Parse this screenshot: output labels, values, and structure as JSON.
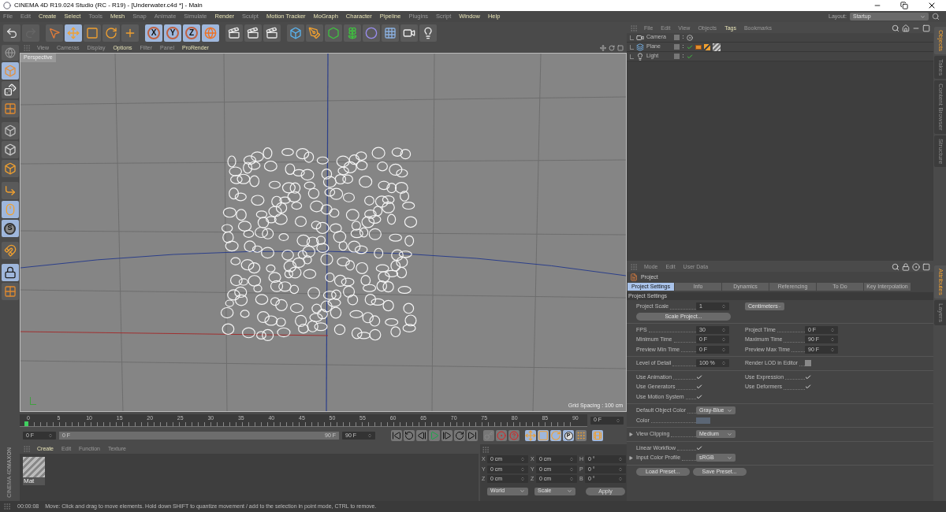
{
  "window": {
    "title": "CINEMA 4D R19.024 Studio (RC - R19) - [Underwater.c4d *] - Main"
  },
  "menubar": [
    {
      "label": "File",
      "highlighted": false
    },
    {
      "label": "Edit",
      "highlighted": false
    },
    {
      "label": "Create",
      "highlighted": true
    },
    {
      "label": "Select",
      "highlighted": true
    },
    {
      "label": "Tools",
      "highlighted": false
    },
    {
      "label": "Mesh",
      "highlighted": true
    },
    {
      "label": "Snap",
      "highlighted": false
    },
    {
      "label": "Animate",
      "highlighted": false
    },
    {
      "label": "Simulate",
      "highlighted": false
    },
    {
      "label": "Render",
      "highlighted": true
    },
    {
      "label": "Sculpt",
      "highlighted": false
    },
    {
      "label": "Motion Tracker",
      "highlighted": true
    },
    {
      "label": "MoGraph",
      "highlighted": true
    },
    {
      "label": "Character",
      "highlighted": true
    },
    {
      "label": "Pipeline",
      "highlighted": true
    },
    {
      "label": "Plugins",
      "highlighted": false
    },
    {
      "label": "Script",
      "highlighted": false
    },
    {
      "label": "Window",
      "highlighted": true
    },
    {
      "label": "Help",
      "highlighted": true
    }
  ],
  "layout": {
    "label": "Layout:",
    "value": "Startup"
  },
  "toolbar": [
    {
      "kind": "undo",
      "selected": false
    },
    {
      "kind": "redo",
      "selected": false
    },
    {
      "kind": "select",
      "selected": false
    },
    {
      "kind": "move",
      "selected": true
    },
    {
      "kind": "scale",
      "selected": false
    },
    {
      "kind": "rotate",
      "selected": false
    },
    {
      "kind": "add",
      "selected": false
    },
    {
      "kind": "axis",
      "label": "X",
      "selected": true
    },
    {
      "kind": "axis",
      "label": "Y",
      "selected": true
    },
    {
      "kind": "axis",
      "label": "Z",
      "selected": true
    },
    {
      "kind": "world",
      "selected": true
    },
    {
      "kind": "render",
      "selected": false
    },
    {
      "kind": "render",
      "selected": false
    },
    {
      "kind": "render",
      "selected": false
    },
    {
      "kind": "cube",
      "selected": false
    },
    {
      "kind": "pen",
      "selected": false
    },
    {
      "kind": "subdivision",
      "selected": false
    },
    {
      "kind": "cloner",
      "selected": false
    },
    {
      "kind": "deformer",
      "selected": false
    },
    {
      "kind": "floor",
      "selected": false
    },
    {
      "kind": "camera",
      "selected": false
    },
    {
      "kind": "light",
      "selected": false
    }
  ],
  "left_toolbar": [
    {
      "kind": "model",
      "selected": true
    },
    {
      "kind": "texture",
      "selected": false
    },
    {
      "kind": "workplane",
      "selected": false
    },
    {
      "kind": "points",
      "selected": false
    },
    {
      "kind": "edges",
      "selected": false
    },
    {
      "kind": "polygons",
      "selected": false
    },
    {
      "kind": "axis",
      "selected": false
    },
    {
      "kind": "tweak",
      "selected": true
    },
    {
      "kind": "letter",
      "label": "S",
      "selected": true
    },
    {
      "kind": "snap",
      "selected": false
    },
    {
      "kind": "lock",
      "selected": true
    },
    {
      "kind": "workplane",
      "selected": false
    }
  ],
  "viewport": {
    "menu": [
      {
        "label": "View",
        "highlighted": false
      },
      {
        "label": "Cameras",
        "highlighted": false
      },
      {
        "label": "Display",
        "highlighted": false
      },
      {
        "label": "Options",
        "highlighted": true
      },
      {
        "label": "Filter",
        "highlighted": false
      },
      {
        "label": "Panel",
        "highlighted": false
      },
      {
        "label": "ProRender",
        "highlighted": true
      }
    ],
    "camera": "Perspective",
    "grid_spacing": "Grid Spacing : 100 cm"
  },
  "timeline": {
    "ticks": [
      "0",
      "5",
      "10",
      "15",
      "20",
      "25",
      "30",
      "35",
      "40",
      "45",
      "50",
      "55",
      "60",
      "65",
      "70",
      "75",
      "80",
      "85",
      "90"
    ],
    "playhead": {
      "level": 0
    },
    "current_frame": "0 F"
  },
  "transport": {
    "start": "0 F",
    "range_start": "0 F",
    "range_end": "90 F",
    "range": {
      "level": 1
    },
    "end": "90 F",
    "buttons": [
      {
        "kind": "first",
        "selected": false
      },
      {
        "kind": "prev-key",
        "selected": false
      },
      {
        "kind": "prev",
        "selected": false
      },
      {
        "kind": "play",
        "selected": false
      },
      {
        "kind": "next",
        "selected": false
      },
      {
        "kind": "next-key",
        "selected": false
      },
      {
        "kind": "last",
        "selected": false
      },
      {
        "kind": "key",
        "selected": false
      },
      {
        "kind": "record",
        "selected": false
      },
      {
        "kind": "auto",
        "selected": false
      },
      {
        "kind": "move",
        "selected": true
      },
      {
        "kind": "scale",
        "selected": true
      },
      {
        "kind": "rotate",
        "selected": true
      },
      {
        "kind": "letter",
        "label": "P",
        "selected": true
      },
      {
        "kind": "grid",
        "selected": false
      },
      {
        "kind": "timeline",
        "selected": true
      }
    ]
  },
  "material_manager": {
    "menu": [
      {
        "label": "Create",
        "highlighted": true
      },
      {
        "label": "Edit",
        "highlighted": false
      },
      {
        "label": "Function",
        "highlighted": false
      },
      {
        "label": "Texture",
        "highlighted": false
      }
    ],
    "materials": [
      {
        "name": "Mat"
      }
    ]
  },
  "coordinates": {
    "rows": [
      {
        "fields": [
          {
            "label": "X",
            "value": "0 cm"
          },
          {
            "label": "X",
            "value": "0 cm"
          },
          {
            "label": "H",
            "value": "0 °"
          }
        ]
      },
      {
        "fields": [
          {
            "label": "Y",
            "value": "0 cm"
          },
          {
            "label": "Y",
            "value": "0 cm"
          },
          {
            "label": "P",
            "value": "0 °"
          }
        ]
      },
      {
        "fields": [
          {
            "label": "Z",
            "value": "0 cm"
          },
          {
            "label": "Z",
            "value": "0 cm"
          },
          {
            "label": "B",
            "value": "0 °"
          }
        ]
      }
    ],
    "mode": "World",
    "transform": "Scale",
    "apply": "Apply"
  },
  "logo": {
    "brand": "MAXON",
    "product": "CINEMA 4D"
  },
  "status_bar": {
    "time": "00:00:08",
    "message": "Move: Click and drag to move elements. Hold down SHIFT to quantize movement / add to the selection in point mode, CTRL to remove."
  },
  "object_manager": {
    "menu": [
      {
        "label": "File",
        "highlighted": false
      },
      {
        "label": "Edit",
        "highlighted": false
      },
      {
        "label": "View",
        "highlighted": false
      },
      {
        "label": "Objects",
        "highlighted": false
      },
      {
        "label": "Tags",
        "highlighted": true
      },
      {
        "label": "Bookmarks",
        "highlighted": false
      }
    ],
    "objects": [
      {
        "kind": "camera",
        "name": "Camera",
        "enabled": false
      },
      {
        "kind": "plane",
        "name": "Plane",
        "enabled": true,
        "tags": [
          {
            "kind": "compositing"
          },
          {
            "kind": "phong"
          },
          {
            "kind": "material"
          }
        ]
      },
      {
        "kind": "light",
        "name": "Light",
        "enabled": true
      }
    ]
  },
  "side_tabs_top": [
    {
      "label": "Objects",
      "selected": true
    },
    {
      "label": "Takes",
      "selected": false
    },
    {
      "label": "Content Browser",
      "selected": false
    },
    {
      "label": "Structure",
      "selected": false
    }
  ],
  "attributes": {
    "menu": [
      {
        "label": "Mode",
        "highlighted": false
      },
      {
        "label": "Edit",
        "highlighted": false
      },
      {
        "label": "User Data",
        "highlighted": false
      }
    ],
    "object": "Project",
    "tabs": [
      {
        "label": "Project Settings",
        "selected": true
      },
      {
        "label": "Info",
        "selected": false
      },
      {
        "label": "Dynamics",
        "selected": false
      },
      {
        "label": "Referencing",
        "selected": false
      },
      {
        "label": "To Do",
        "selected": false
      },
      {
        "label": "Key Interpolation",
        "selected": false
      }
    ],
    "section": "Project Settings",
    "groups": [
      {
        "rows": [
          {
            "cells": [
              {
                "kind": "number",
                "label": "Project Scale",
                "value": "1"
              },
              {
                "kind": "dropdown",
                "value": "Centimeters"
              }
            ]
          },
          {
            "cells": [
              {
                "kind": "button",
                "label": "Scale Project..."
              }
            ]
          }
        ]
      },
      {
        "rows": [
          {
            "cells": [
              {
                "kind": "number",
                "label": "FPS",
                "value": "30"
              },
              {
                "kind": "number",
                "label": "Project Time",
                "value": "0 F"
              }
            ]
          },
          {
            "cells": [
              {
                "kind": "number",
                "label": "Minimum Time",
                "value": "0 F"
              },
              {
                "kind": "number",
                "label": "Maximum Time",
                "value": "90 F"
              }
            ]
          },
          {
            "cells": [
              {
                "kind": "number",
                "label": "Preview Min Time",
                "value": "0 F"
              },
              {
                "kind": "number",
                "label": "Preview Max Time",
                "value": "90 F"
              }
            ]
          }
        ]
      },
      {
        "rows": [
          {
            "cells": [
              {
                "kind": "number",
                "label": "Level of Detail",
                "value": "100 %"
              },
              {
                "kind": "checkbox",
                "label": "Render LOD in Editor",
                "checked": false
              }
            ]
          }
        ]
      },
      {
        "rows": [
          {
            "cells": [
              {
                "kind": "checkbox",
                "label": "Use Animation",
                "checked": true
              },
              {
                "kind": "checkbox",
                "label": "Use Expression",
                "checked": true
              }
            ]
          },
          {
            "cells": [
              {
                "kind": "checkbox",
                "label": "Use Generators",
                "checked": true
              },
              {
                "kind": "checkbox",
                "label": "Use Deformers",
                "checked": true
              }
            ]
          },
          {
            "cells": [
              {
                "kind": "checkbox",
                "label": "Use Motion System",
                "checked": true
              }
            ]
          }
        ]
      },
      {
        "rows": [
          {
            "cells": [
              {
                "kind": "dropdown",
                "label": "Default Object Color",
                "value": "Gray-Blue"
              }
            ]
          },
          {
            "cells": [
              {
                "kind": "color",
                "label": "Color",
                "color": "#5b6675"
              }
            ]
          }
        ]
      },
      {
        "rows": [
          {
            "cells": [
              {
                "kind": "dropdown",
                "label": "View Clipping",
                "value": "Medium",
                "expanded": false
              }
            ]
          }
        ]
      },
      {
        "rows": [
          {
            "cells": [
              {
                "kind": "checkbox",
                "label": "Linear Workflow",
                "checked": true
              }
            ]
          },
          {
            "cells": [
              {
                "kind": "dropdown",
                "label": "Input Color Profile",
                "value": "sRGB",
                "expanded": false
              }
            ]
          }
        ]
      },
      {
        "rows": [
          {
            "cells": [
              {
                "kind": "button",
                "label": "Load Preset..."
              },
              {
                "kind": "button",
                "label": "Save Preset..."
              }
            ]
          }
        ]
      }
    ]
  },
  "side_tabs_bottom": [
    {
      "label": "Attributes",
      "selected": true
    },
    {
      "label": "Layers",
      "selected": false
    }
  ]
}
